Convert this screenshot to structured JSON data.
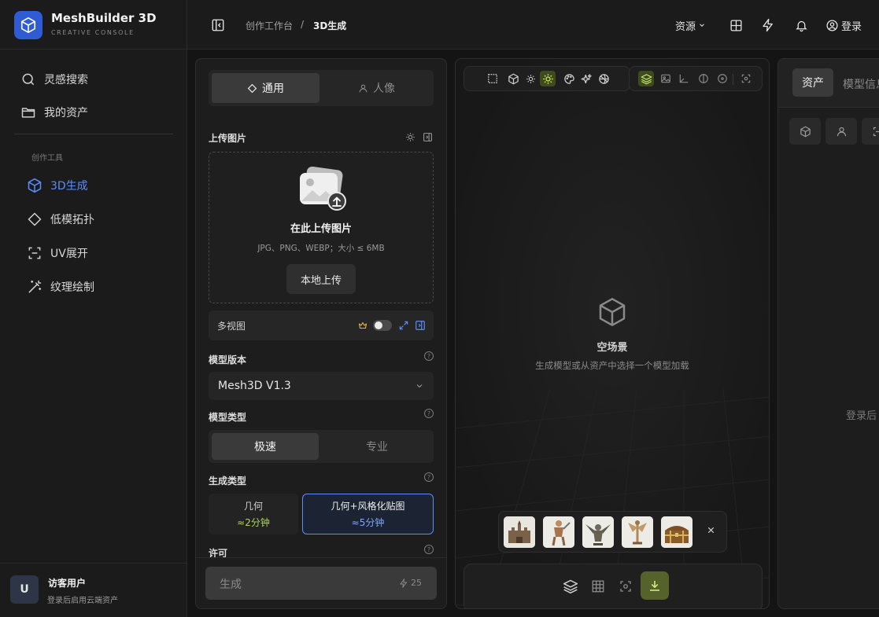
{
  "brand": {
    "name": "MeshBuilder 3D",
    "subtitle": "CREATIVE CONSOLE"
  },
  "nav": {
    "search": "灵感搜索",
    "assets": "我的资产",
    "section_title": "创作工具",
    "tools": [
      "3D生成",
      "低模拓扑",
      "UV展开",
      "纹理绘制"
    ]
  },
  "user": {
    "avatar": "U",
    "name": "访客用户",
    "hint": "登录后启用云端资产"
  },
  "topbar": {
    "crumb_parent": "创作工作台",
    "crumb_sep": "/",
    "crumb_current": "3D生成",
    "resources": "资源",
    "login": "登录"
  },
  "left_panel": {
    "tabs": [
      "通用",
      "人像"
    ],
    "upload_label": "上传图片",
    "upload_title": "在此上传图片",
    "upload_hint": "JPG、PNG、WEBP；大小 ≤ 6MB",
    "upload_button": "本地上传",
    "multiview_label": "多视图",
    "multiview_enabled": false,
    "model_version_label": "模型版本",
    "model_version_value": "Mesh3D V1.3",
    "model_type_label": "模型类型",
    "model_types": [
      "极速",
      "专业"
    ],
    "gen_type_label": "生成类型",
    "gen_types": [
      {
        "name": "几何",
        "time": "≈2分钟"
      },
      {
        "name": "几何+风格化贴图",
        "time": "≈5分钟"
      }
    ],
    "license_label": "许可",
    "generate_button": "生成",
    "generate_cost": "25"
  },
  "viewport": {
    "empty_title": "空场景",
    "empty_hint": "生成模型或从资产中选择一个模型加载",
    "samples": [
      "castle",
      "warrior",
      "gargoyle",
      "dragon",
      "chest"
    ]
  },
  "right_panel": {
    "tabs": [
      "资产",
      "模型信息"
    ],
    "login_hint": "登录后"
  },
  "colors": {
    "accent": "#5d8dfa",
    "lime": "#a9d65b",
    "brand": "#2f5bd3"
  }
}
